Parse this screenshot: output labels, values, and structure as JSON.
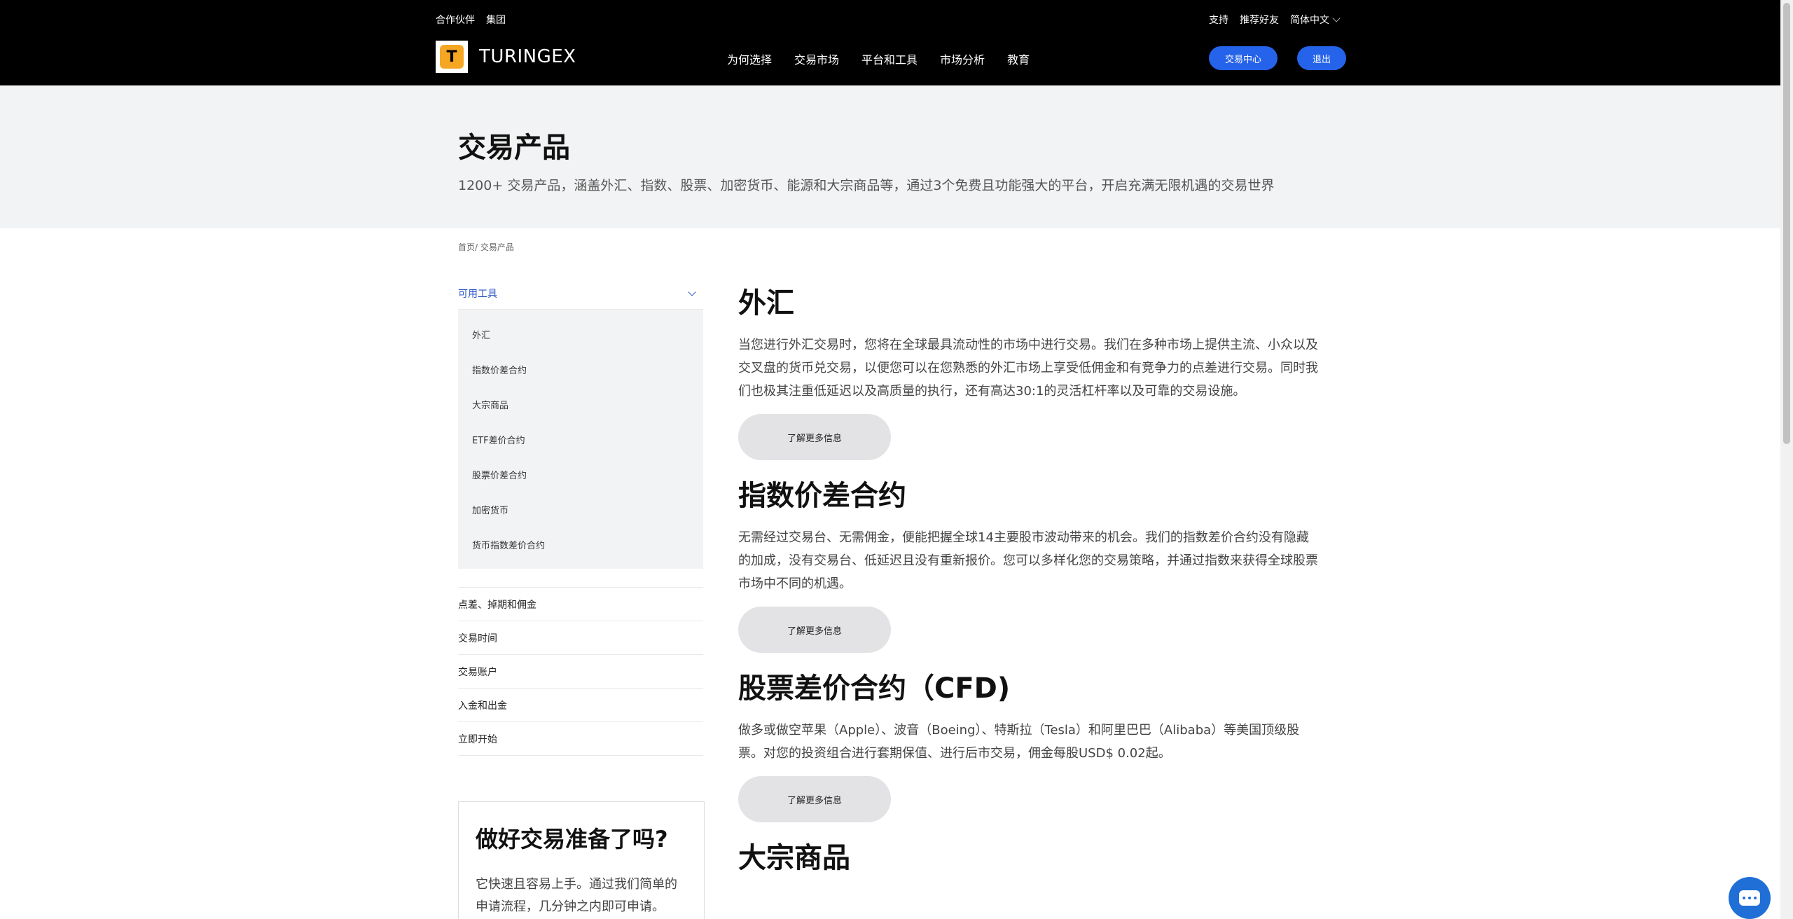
{
  "header": {
    "top_left": [
      "合作伙伴",
      "集团"
    ],
    "top_right": [
      "支持",
      "推荐好友"
    ],
    "language": "简体中文",
    "logo_text": "TURINGEX",
    "nav": [
      "为何选择",
      "交易市场",
      "平台和工具",
      "市场分析",
      "教育"
    ],
    "trade_center_label": "交易中心",
    "logout_label": "退出",
    "accent_color": "#2563eb"
  },
  "hero": {
    "title": "交易产品",
    "subtitle": "1200+ 交易产品，涵盖外汇、指数、股票、加密货币、能源和大宗商品等，通过3个免费且功能强大的平台，开启充满无限机遇的交易世界"
  },
  "breadcrumb": "首页/ 交易产品",
  "sidebar": {
    "section_title": "可用工具",
    "sub_items": [
      "外汇",
      "指数价差合约",
      "大宗商品",
      "ETF差价合约",
      "股票价差合约",
      "加密货币",
      "货币指数差价合约"
    ],
    "links": [
      "点差、掉期和佣金",
      "交易时间",
      "交易账户",
      "入金和出金",
      "立即开始"
    ]
  },
  "ready": {
    "title": "做好交易准备了吗?",
    "text": "它快速且容易上手。通过我们简单的申请流程，几分钟之内即可申请。"
  },
  "main": {
    "sections": [
      {
        "title": "外汇",
        "text": "当您进行外汇交易时，您将在全球最具流动性的市场中进行交易。我们在多种市场上提供主流、小众以及交叉盘的货币兑交易，以便您可以在您熟悉的外汇市场上享受低佣金和有竞争力的点差进行交易。同时我们也极其注重低延迟以及高质量的执行，还有高达30:1的灵活杠杆率以及可靠的交易设施。",
        "button": "了解更多信息"
      },
      {
        "title": "指数价差合约",
        "text": "无需经过交易台、无需佣金，便能把握全球14主要股市波动带来的机会。我们的指数差价合约没有隐藏的加成，没有交易台、低延迟且没有重新报价。您可以多样化您的交易策略，并通过指数来获得全球股票市场中不同的机遇。",
        "button": "了解更多信息"
      },
      {
        "title": "股票差价合约（CFD)",
        "text": "做多或做空苹果（Apple）、波音（Boeing）、特斯拉（Tesla）和阿里巴巴（Alibaba）等美国顶级股票。对您的投资组合进行套期保值、进行后市交易，佣金每股USD$ 0.02起。",
        "button": "了解更多信息"
      },
      {
        "title": "大宗商品",
        "text": "",
        "button": ""
      }
    ]
  }
}
